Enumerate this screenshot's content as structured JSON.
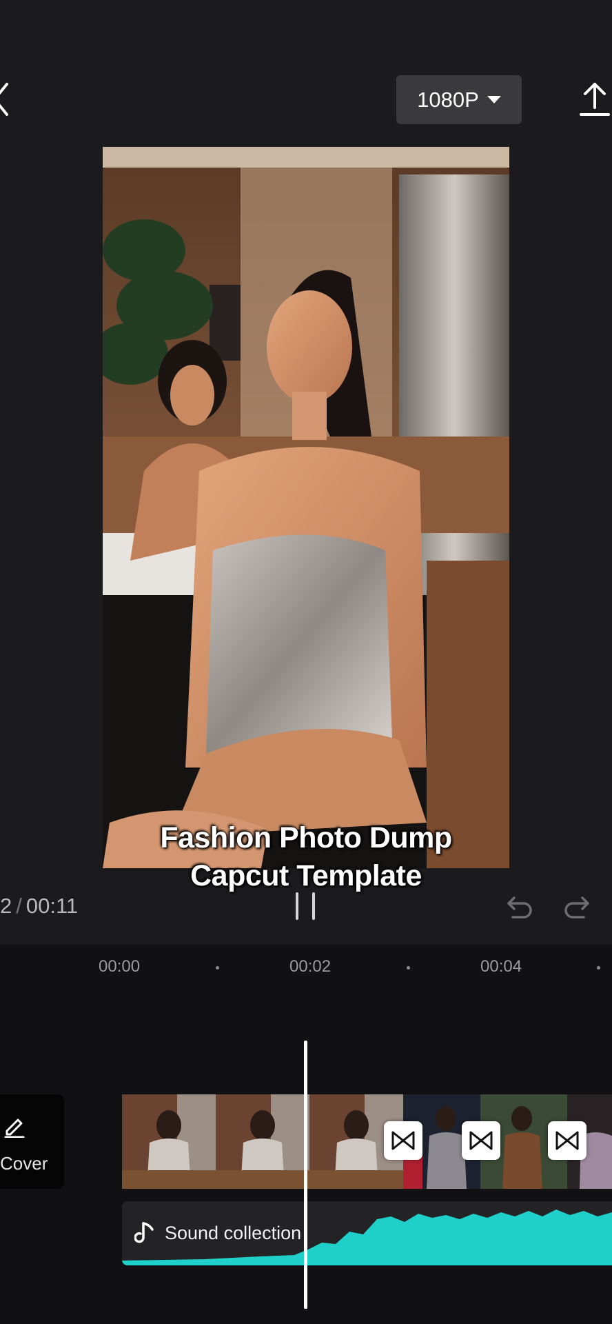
{
  "header": {
    "resolution_label": "1080P"
  },
  "preview": {
    "caption_line1": "Fashion Photo Dump",
    "caption_line2": "Capcut Template"
  },
  "playback": {
    "current_time": "2",
    "separator": "/",
    "total_time": "00:11"
  },
  "ruler": {
    "labels": [
      "00:00",
      "00:02",
      "00:04"
    ]
  },
  "timeline": {
    "cover_label": "Cover",
    "audio_label": "Sound collection"
  },
  "colors": {
    "background": "#1b1b1e",
    "timeline_bg": "#111113",
    "waveform": "#1fcfc9",
    "button_bg": "#3a3a3d"
  }
}
